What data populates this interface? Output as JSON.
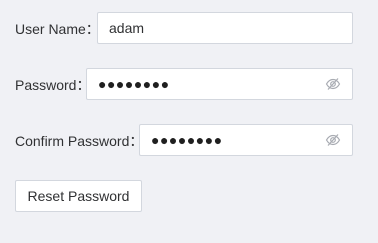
{
  "form": {
    "username": {
      "label": "User Name：",
      "value": "adam"
    },
    "password": {
      "label": "Password：",
      "mask": "●●●●●●●●",
      "icon": "eye-off-icon"
    },
    "confirm_password": {
      "label": "Confirm Password：",
      "mask": "●●●●●●●●",
      "icon": "eye-off-icon"
    },
    "reset_button_label": "Reset Password"
  },
  "colors": {
    "background": "#f0f1f5",
    "input_border": "#d3d7de",
    "text": "#303133",
    "icon": "#a8abb2"
  }
}
